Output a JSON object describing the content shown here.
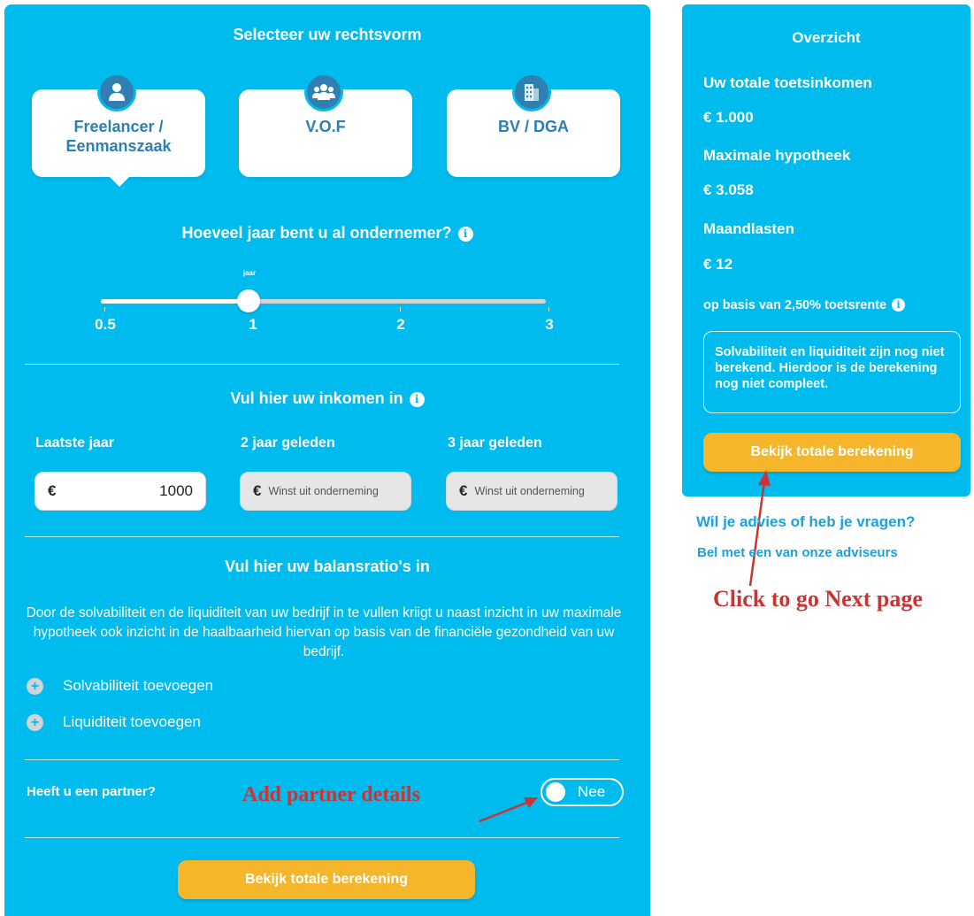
{
  "rechtsvorm": {
    "title": "Selecteer uw rechtsvorm",
    "options": [
      {
        "label": "Freelancer / Eenmanszaak",
        "line1": "Freelancer /",
        "line2": "Eenmanszaak",
        "icon": "user-icon",
        "selected": true
      },
      {
        "label": "V.O.F",
        "icon": "group-icon",
        "selected": false
      },
      {
        "label": "BV / DGA",
        "icon": "building-icon",
        "selected": false
      }
    ]
  },
  "years": {
    "question": "Hoeveel jaar bent u al ondernemer?",
    "unit_label": "jaar",
    "ticks": [
      "0.5",
      "1",
      "2",
      "3"
    ],
    "value": "1"
  },
  "income": {
    "title": "Vul hier uw inkomen in",
    "currency": "€",
    "columns": [
      {
        "label": "Laatste jaar",
        "value": "1000",
        "placeholder": ""
      },
      {
        "label": "2 jaar geleden",
        "value": "",
        "placeholder": "Winst uit onderneming"
      },
      {
        "label": "3 jaar geleden",
        "value": "",
        "placeholder": "Winst uit onderneming"
      }
    ]
  },
  "balance": {
    "title": "Vul hier uw balansratio's in",
    "description": "Door de solvabiliteit en de liquiditeit van uw bedrijf in te vullen kriigt u naast inzicht in uw maximale hypotheek ook inzicht in de haalbaarheid hiervan op basis van de financiële gezondheid van uw bedrijf.",
    "add_solvency": "Solvabiliteit toevoegen",
    "add_liquidity": "Liquiditeit toevoegen"
  },
  "partner": {
    "question": "Heeft u een partner?",
    "toggle_label": "Nee",
    "annotation": "Add partner details"
  },
  "main_cta": "Bekijk totale berekening",
  "overview": {
    "title": "Overzicht",
    "income_label": "Uw totale toetsinkomen",
    "income_value": "€ 1.000",
    "mortgage_label": "Maximale hypotheek",
    "mortgage_value": "€ 3.058",
    "monthly_label": "Maandlasten",
    "monthly_value": "€ 12",
    "rate_note": "op basis van 2,50% toetsrente",
    "warning": "Solvabiliteit en liquiditeit zijn nog niet berekend. Hierdoor is de berekening nog niet compleet.",
    "cta": "Bekijk totale berekening"
  },
  "advice": {
    "question": "Wil je advies of heb je vragen?",
    "call": "Bel met een van onze adviseurs"
  },
  "annotations": {
    "next_page": "Click to go Next page"
  },
  "colors": {
    "panel": "#00bbee",
    "card_text": "#2e7fad",
    "cta": "#f6b62c",
    "annotation": "#cc3333",
    "link": "#1ea0dc"
  }
}
